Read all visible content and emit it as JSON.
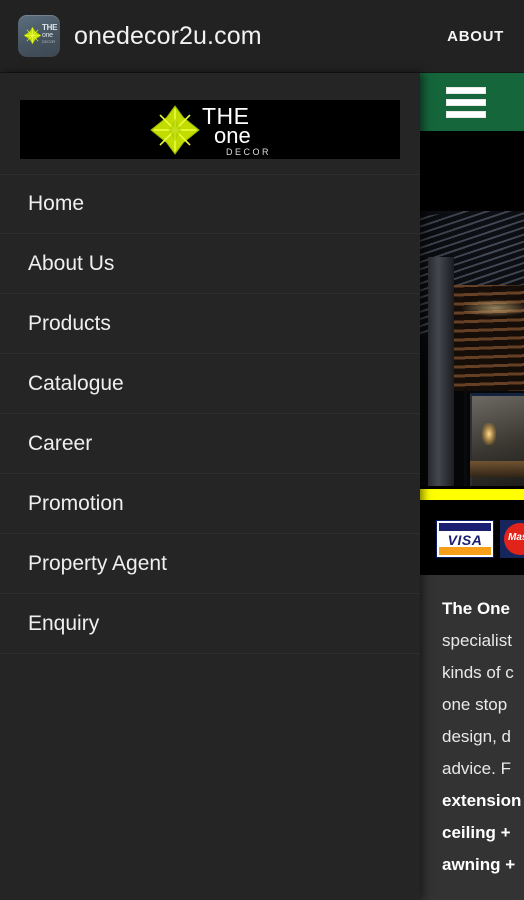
{
  "topbar": {
    "app_title": "onedecor2u.com",
    "about_label": "ABOUT",
    "icon_name": "app-logo-icon",
    "icon_the": "THE",
    "icon_one": "one",
    "icon_decor": "DECOR",
    "background": "#222222"
  },
  "drawer": {
    "logo": {
      "the": "THE",
      "one": "one",
      "decor": "DECOR",
      "star_color": "#c8e000",
      "background": "#000000"
    },
    "items": [
      {
        "label": "Home"
      },
      {
        "label": "About Us"
      },
      {
        "label": "Products"
      },
      {
        "label": "Catalogue"
      },
      {
        "label": "Career"
      },
      {
        "label": "Promotion"
      },
      {
        "label": "Property Agent"
      },
      {
        "label": "Enquiry"
      }
    ],
    "background": "#252525"
  },
  "page": {
    "header": {
      "menu_icon": "hamburger-icon",
      "background": "#15663b"
    },
    "hero": {
      "alt": "night photo of louvered pergola facade with lit interior"
    },
    "divider_color": "#ffff00",
    "payments": [
      {
        "name": "visa-card-logo",
        "label": "VISA"
      },
      {
        "name": "mastercard-logo",
        "label": "Mast"
      }
    ],
    "copy_lines": [
      {
        "text": "The One ",
        "bold": true
      },
      {
        "text": "specialist",
        "bold": false
      },
      {
        "text": "kinds of c",
        "bold": false
      },
      {
        "text": "one stop ",
        "bold": false
      },
      {
        "text": "design, d",
        "bold": false
      },
      {
        "text": "advice. F",
        "bold": false
      },
      {
        "text": "extension",
        "bold": true
      },
      {
        "text": "ceiling + ",
        "bold": true
      },
      {
        "text": "awning + ",
        "bold": true
      }
    ]
  }
}
